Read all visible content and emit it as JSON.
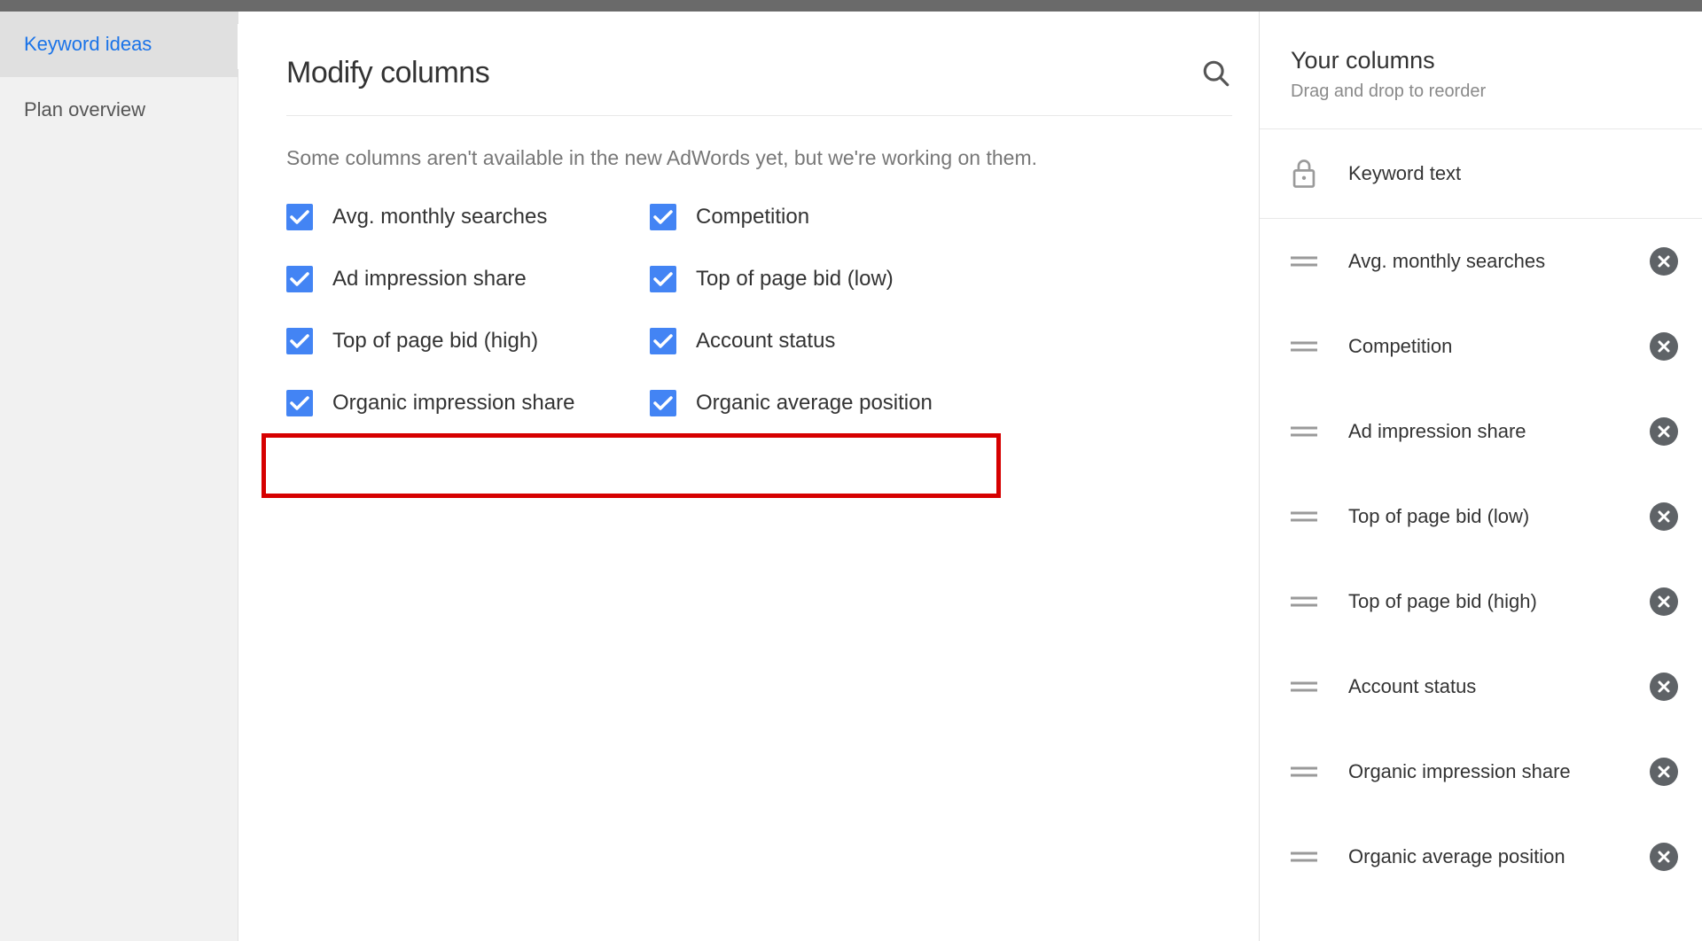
{
  "sidebar": {
    "items": [
      {
        "label": "Keyword ideas",
        "active": true
      },
      {
        "label": "Plan overview",
        "active": false
      }
    ]
  },
  "main": {
    "title": "Modify columns",
    "subtext": "Some columns aren't available in the new AdWords yet, but we're working on them.",
    "checks": [
      {
        "label": "Avg. monthly searches",
        "highlighted": false
      },
      {
        "label": "Competition",
        "highlighted": false
      },
      {
        "label": "Ad impression share",
        "highlighted": false
      },
      {
        "label": "Top of page bid (low)",
        "highlighted": false
      },
      {
        "label": "Top of page bid (high)",
        "highlighted": false
      },
      {
        "label": "Account status",
        "highlighted": false
      },
      {
        "label": "Organic impression share",
        "highlighted": true
      },
      {
        "label": "Organic average position",
        "highlighted": true
      }
    ]
  },
  "right": {
    "title": "Your columns",
    "subtitle": "Drag and drop to reorder",
    "locked": "Keyword text",
    "columns": [
      "Avg. monthly searches",
      "Competition",
      "Ad impression share",
      "Top of page bid (low)",
      "Top of page bid (high)",
      "Account status",
      "Organic impression share",
      "Organic average position"
    ]
  }
}
